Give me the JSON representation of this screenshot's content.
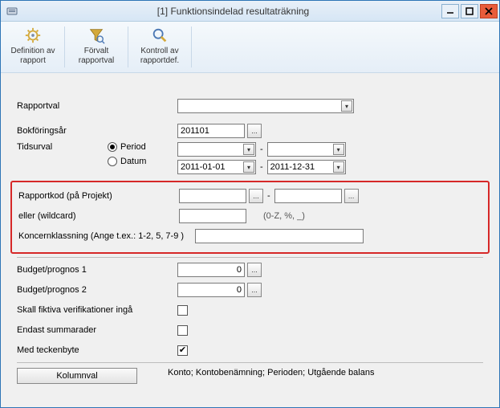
{
  "window": {
    "title": "[1]  Funktionsindelad resultaträkning",
    "minimize": "—",
    "maximize": "▢",
    "close": "×"
  },
  "toolbar": {
    "items": [
      {
        "label": "Definition av rapport"
      },
      {
        "label": "Förvalt rapportval"
      },
      {
        "label": "Kontroll av rapportdef."
      }
    ]
  },
  "labels": {
    "rapportval": "Rapportval",
    "bokforingsar": "Bokföringsår",
    "tidsurval": "Tidsurval",
    "period": "Period",
    "datum": "Datum",
    "rapportkod": "Rapportkod (på Projekt)",
    "eller_wildcard": "eller (wildcard)",
    "wildcard_hint": "(0-Z, %, _)",
    "koncernklassning": "Koncernklassning (Ange t.ex.: 1-2, 5, 7-9 )",
    "budget1": "Budget/prognos 1",
    "budget2": "Budget/prognos 2",
    "fiktiva": "Skall fiktiva verifikationer ingå",
    "summarader": "Endast summarader",
    "teckenbyte": "Med teckenbyte",
    "kolumnval": "Kolumnval",
    "footer": "Konto; Kontobenämning; Perioden; Utgående balans"
  },
  "values": {
    "rapportval": "",
    "bokforingsar": "201101",
    "period_from": "",
    "period_to": "",
    "datum_from": "2011-01-01",
    "datum_to": "2011-12-31",
    "rapportkod_from": "",
    "rapportkod_to": "",
    "wildcard": "",
    "koncernklassning": "",
    "budget1": "0",
    "budget2": "0",
    "fiktiva_checked": false,
    "summarader_checked": false,
    "teckenbyte_checked": true,
    "tidsurval_selected": "period"
  },
  "glyphs": {
    "lookup": "...",
    "dash": "-",
    "check": "✔",
    "dropdown": "▾"
  }
}
